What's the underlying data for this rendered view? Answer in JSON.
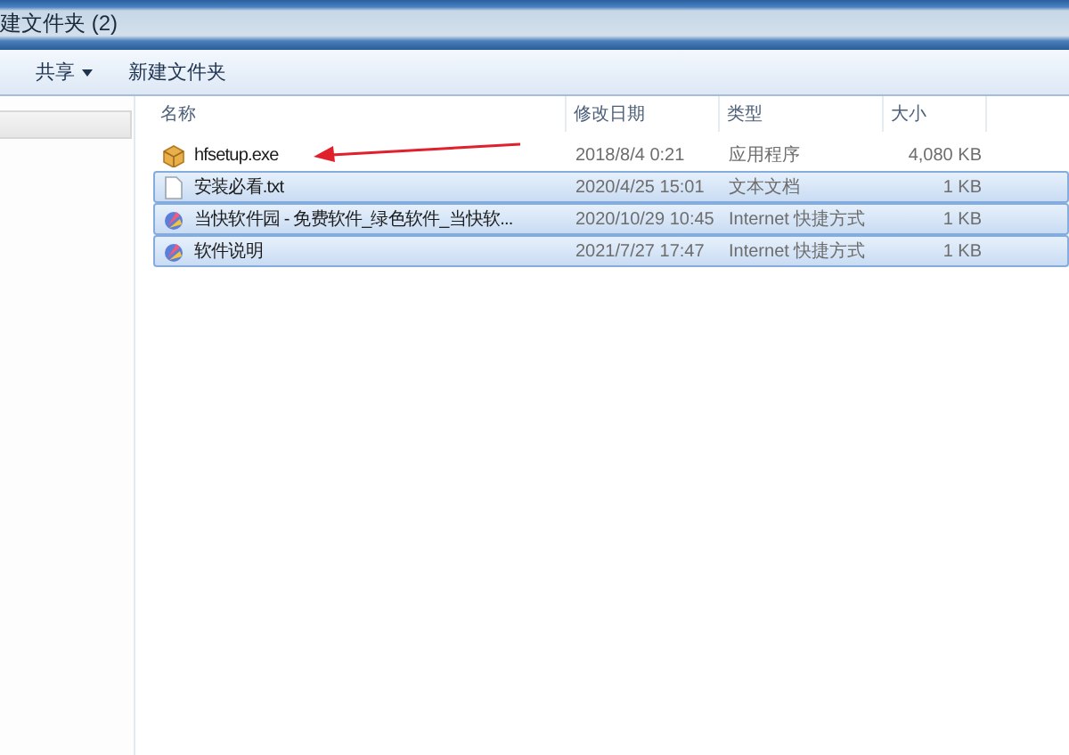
{
  "window": {
    "title": "建文件夹 (2)"
  },
  "toolbar": [
    {
      "label": "共享",
      "dropdown": true
    },
    {
      "label": "新建文件夹",
      "dropdown": false
    }
  ],
  "columns": [
    "名称",
    "修改日期",
    "类型",
    "大小"
  ],
  "rows": [
    {
      "kind": "exe",
      "name": "hfsetup.exe",
      "date": "2018/8/4 0:21",
      "type": "应用程序",
      "size": "4,080 KB",
      "selected": false
    },
    {
      "kind": "txt",
      "name": "安装必看.txt",
      "date": "2020/4/25 15:01",
      "type": "文本文档",
      "size": "1 KB",
      "selected": true
    },
    {
      "kind": "url",
      "name": "当快软件园 - 免费软件_绿色软件_当快软...",
      "date": "2020/10/29 10:45",
      "type": "Internet 快捷方式",
      "size": "1 KB",
      "selected": true
    },
    {
      "kind": "url",
      "name": "软件说明",
      "date": "2021/7/27 17:47",
      "type": "Internet 快捷方式",
      "size": "1 KB",
      "selected": true
    }
  ]
}
